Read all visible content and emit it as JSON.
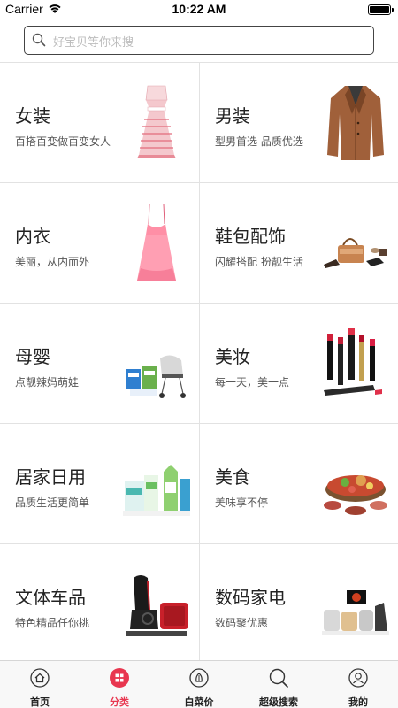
{
  "status_bar": {
    "carrier": "Carrier",
    "time": "10:22 AM"
  },
  "search": {
    "placeholder": "好宝贝等你来搜"
  },
  "categories": [
    {
      "title": "女装",
      "subtitle": "百搭百变做百变女人",
      "icon": "dress-image"
    },
    {
      "title": "男装",
      "subtitle": "型男首选 品质优选",
      "icon": "coat-image"
    },
    {
      "title": "内衣",
      "subtitle": "美丽，从内而外",
      "icon": "nightdress-image"
    },
    {
      "title": "鞋包配饰",
      "subtitle": "闪耀搭配 扮靓生活",
      "icon": "shoes-bags-image"
    },
    {
      "title": "母婴",
      "subtitle": "点靓辣妈萌娃",
      "icon": "baby-products-image"
    },
    {
      "title": "美妆",
      "subtitle": "每一天，美一点",
      "icon": "lipstick-image"
    },
    {
      "title": "居家日用",
      "subtitle": "品质生活更简单",
      "icon": "household-image"
    },
    {
      "title": "美食",
      "subtitle": "美味享不停",
      "icon": "food-image"
    },
    {
      "title": "文体车品",
      "subtitle": "特色精品任你挑",
      "icon": "car-seat-image"
    },
    {
      "title": "数码家电",
      "subtitle": "数码聚优惠",
      "icon": "appliance-image"
    }
  ],
  "tabbar": {
    "active": "分类",
    "accent_color": "#e8364f",
    "tabs": [
      {
        "label": "首页",
        "icon": "home-icon"
      },
      {
        "label": "分类",
        "icon": "category-icon"
      },
      {
        "label": "白菜价",
        "icon": "cabbage-icon"
      },
      {
        "label": "超级搜索",
        "icon": "search-icon"
      },
      {
        "label": "我的",
        "icon": "user-icon"
      }
    ]
  }
}
